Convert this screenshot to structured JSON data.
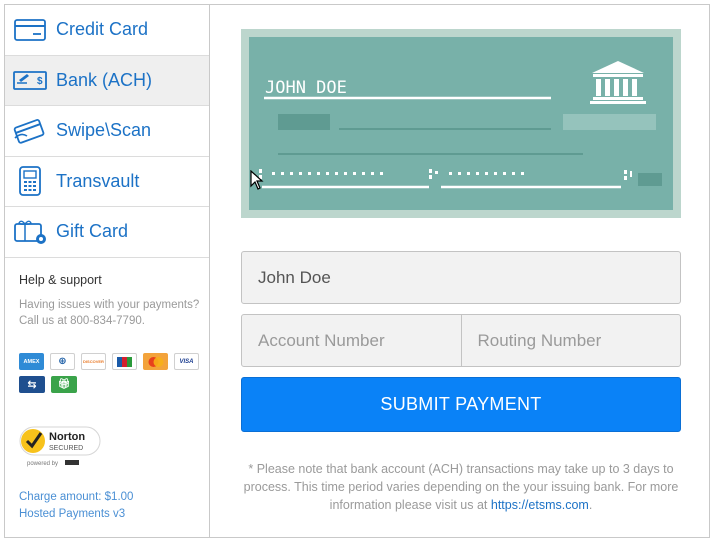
{
  "sidebar": {
    "items": [
      {
        "label": "Credit Card",
        "icon": "credit-card-icon",
        "active": false
      },
      {
        "label": "Bank (ACH)",
        "icon": "check-icon",
        "active": true
      },
      {
        "label": "Swipe\\Scan",
        "icon": "swipe-card-icon",
        "active": false
      },
      {
        "label": "Transvault",
        "icon": "terminal-icon",
        "active": false
      },
      {
        "label": "Gift Card",
        "icon": "gift-card-icon",
        "active": false
      }
    ],
    "help": {
      "title": "Help & support",
      "line1": "Having issues with your payments?",
      "line2": "Call us at 800-834-7790."
    },
    "card_logos": [
      "AMEX",
      "DINERS",
      "DISCOVER",
      "JCB",
      "MC",
      "VISA"
    ],
    "norton": {
      "brand": "Norton",
      "sub": "SECURED",
      "powered": "powered by"
    },
    "charge_amount": "Charge amount: $1.00",
    "version": "Hosted Payments v3"
  },
  "check": {
    "payee_name": "JOHN DOE",
    "icon": "bank-building-icon"
  },
  "form": {
    "name_value": "John Doe",
    "account_placeholder": "Account Number",
    "routing_placeholder": "Routing Number",
    "submit_label": "SUBMIT PAYMENT"
  },
  "note": {
    "text": "* Please note that bank account (ACH) transactions may take up to 3 days to process. This time period varies depending on the your issuing bank. For more information please visit us at ",
    "link": "https://etsms.com",
    "suffix": "."
  },
  "colors": {
    "accent": "#1c72c6",
    "button": "#0a82f7",
    "check_body": "#78b1a9",
    "check_border": "#bcd6cd"
  }
}
